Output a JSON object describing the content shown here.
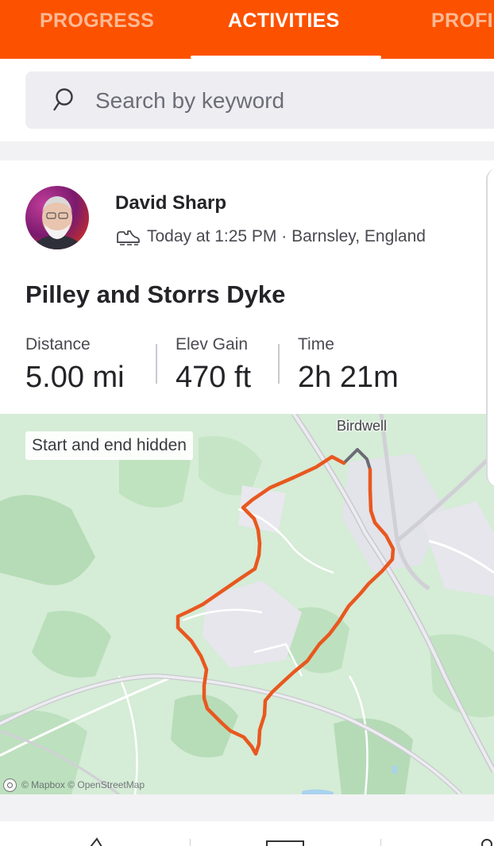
{
  "tabs": [
    {
      "label": "PROGRESS",
      "active": false
    },
    {
      "label": "ACTIVITIES",
      "active": true
    },
    {
      "label": "PROFILE",
      "active": false
    }
  ],
  "search": {
    "placeholder": "Search by keyword",
    "icon": "search-icon"
  },
  "activity": {
    "athlete": "David Sharp",
    "meta": "Today at 1:25 PM · Barnsley, England",
    "sport_icon": "walking-shoe-icon",
    "title": "Pilley and Storrs Dyke",
    "stats": [
      {
        "label": "Distance",
        "value": "5.00 mi"
      },
      {
        "label": "Elev Gain",
        "value": "470 ft"
      },
      {
        "label": "Time",
        "value": "2h 21m"
      }
    ],
    "map": {
      "privacy_badge": "Start and end hidden",
      "place_label": "Birdwell",
      "attribution": "© Mapbox © OpenStreetMap",
      "route_color": "#e8581f"
    }
  },
  "colors": {
    "brand": "#fc5200",
    "text": "#242428",
    "muted": "#494950"
  }
}
